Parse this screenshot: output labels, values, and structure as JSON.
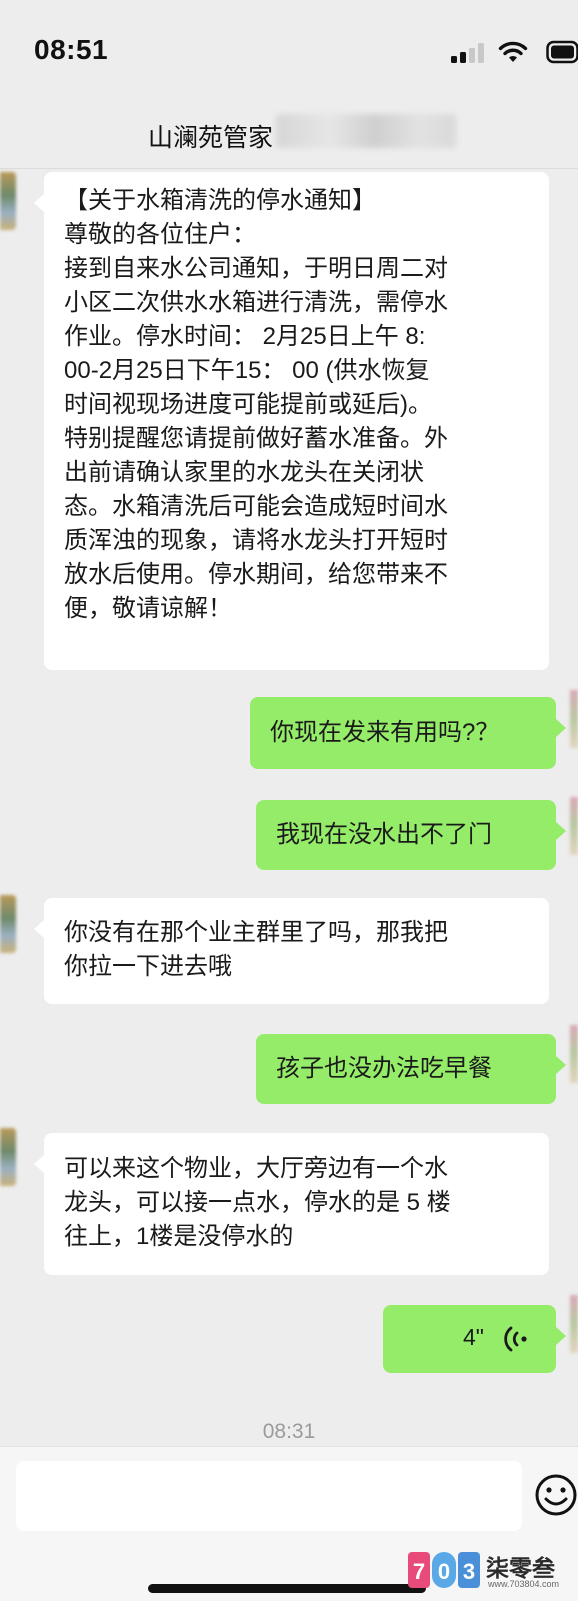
{
  "status_bar": {
    "time": "08:51"
  },
  "header": {
    "title": "山澜苑管家"
  },
  "messages": [
    {
      "side": "in",
      "lines": [
        "【关于水箱清洗的停水通知】",
        "尊敬的各位住户：",
        "接到自来水公司通知，于明日周二对",
        "小区二次供水水箱进行清洗，需停水",
        "作业。停水时间： 2月25日上午 8:",
        "00-2月25日下午15： 00 (供水恢复",
        "时间视现场进度可能提前或延后)。",
        "特别提醒您请提前做好蓄水准备。外",
        "出前请确认家里的水龙头在关闭状",
        "态。水箱清洗后可能会造成短时间水",
        "质浑浊的现象，请将水龙头打开短时",
        "放水后使用。停水期间，给您带来不",
        "便，敬请谅解！"
      ]
    },
    {
      "side": "out",
      "text": "你现在发来有用吗?？"
    },
    {
      "side": "out",
      "text": "我现在没水出不了门"
    },
    {
      "side": "in",
      "lines": [
        "你没有在那个业主群里了吗，那我把",
        "你拉一下进去哦"
      ]
    },
    {
      "side": "out",
      "text": "孩子也没办法吃早餐"
    },
    {
      "side": "in",
      "lines": [
        "可以来这个物业，大厅旁边有一个水",
        "龙头，可以接一点水，停水的是 5 楼",
        "往上，1楼是没停水的"
      ]
    },
    {
      "side": "out",
      "voice_duration": "4\""
    }
  ],
  "timestamp": "08:31",
  "input_bar": {
    "placeholder": ""
  },
  "watermark": {
    "logo_text": "703",
    "text": "柒零叁",
    "url": "www.703804.com"
  },
  "icons": {
    "signal": "cellular-signal-icon",
    "wifi": "wifi-icon",
    "battery": "battery-icon",
    "voice": "voice-wave-icon",
    "emoji": "emoji-icon"
  },
  "colors": {
    "chat_background": "#ededed",
    "incoming_bubble": "#ffffff",
    "outgoing_bubble": "#95ec69",
    "timestamp_text": "#9b9b9b"
  }
}
